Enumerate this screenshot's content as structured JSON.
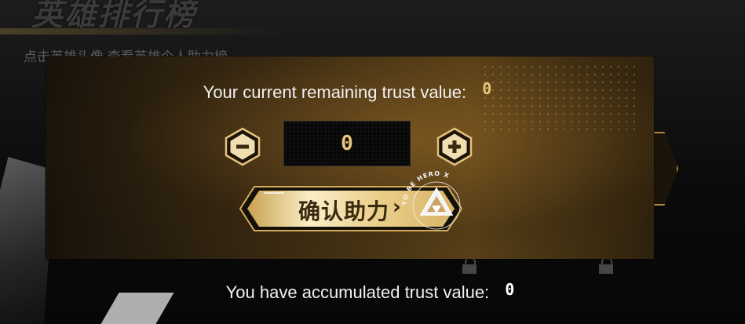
{
  "background": {
    "page_title": "英雄排行榜",
    "subtitle": "点击英雄头像 查看英雄个人助力榜"
  },
  "dialog": {
    "remaining_label": "Your current remaining trust value:",
    "remaining_value": "0",
    "stepper": {
      "decrement_symbol": "−",
      "value": "0",
      "increment_symbol": "+"
    },
    "confirm_label": "确认助力",
    "confirm_arrow": "›",
    "badge_text": "TO BE HERO X"
  },
  "footer": {
    "accumulated_label": "You have accumulated trust value:",
    "accumulated_value": "0"
  },
  "colors": {
    "gold": "#e9c47a",
    "panel": "#3a2a12",
    "button_gold": "#e7cc86"
  },
  "icons": [
    "minus-icon",
    "plus-icon",
    "chevron-right-icon",
    "to-be-hero-x-badge-icon",
    "lock-icon"
  ]
}
